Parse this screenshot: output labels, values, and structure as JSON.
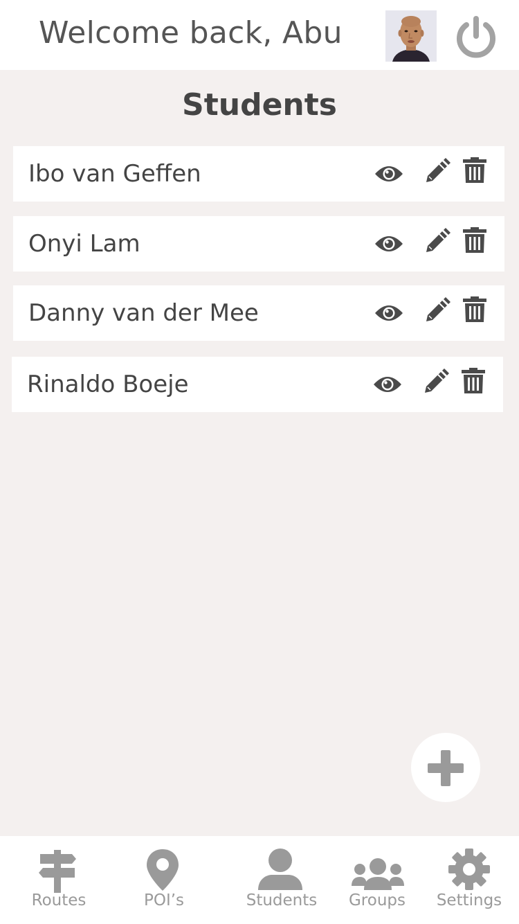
{
  "header": {
    "welcome_text": "Welcome back, Abu"
  },
  "page": {
    "title": "Students"
  },
  "students": [
    {
      "name": "Ibo van Geffen"
    },
    {
      "name": "Onyi Lam"
    },
    {
      "name": "Danny van der Mee"
    },
    {
      "name": "Rinaldo Boeje"
    }
  ],
  "nav": {
    "items": [
      {
        "label": "Routes",
        "icon": "signpost-icon"
      },
      {
        "label": "POI’s",
        "icon": "map-pin-icon"
      },
      {
        "label": "Students",
        "icon": "user-icon"
      },
      {
        "label": "Groups",
        "icon": "users-group-icon"
      },
      {
        "label": "Settings",
        "icon": "gear-icon"
      }
    ]
  },
  "colors": {
    "background": "#f4f0ef",
    "card": "#ffffff",
    "text": "#444444",
    "icon_dark": "#4a4a4a",
    "icon_muted": "#9a9a9a"
  }
}
